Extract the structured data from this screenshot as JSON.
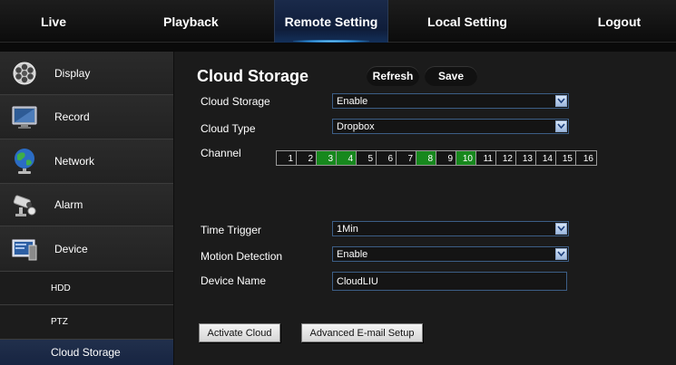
{
  "topnav": {
    "tabs": [
      {
        "label": "Live"
      },
      {
        "label": "Playback"
      },
      {
        "label": "Remote Setting"
      },
      {
        "label": "Local Setting"
      },
      {
        "label": "Logout"
      }
    ],
    "active_tab": "Remote Setting"
  },
  "sidebar": {
    "items": [
      {
        "label": "Display",
        "icon": "film-reel-icon"
      },
      {
        "label": "Record",
        "icon": "monitor-icon"
      },
      {
        "label": "Network",
        "icon": "globe-icon"
      },
      {
        "label": "Alarm",
        "icon": "security-camera-icon"
      },
      {
        "label": "Device",
        "icon": "device-icon"
      }
    ],
    "sub_items": [
      {
        "label": "HDD"
      },
      {
        "label": "PTZ"
      },
      {
        "label": "Cloud Storage"
      }
    ],
    "active_sub_item": "Cloud Storage"
  },
  "main": {
    "title": "Cloud Storage",
    "refresh_label": "Refresh",
    "save_label": "Save",
    "fields": {
      "cloud_storage": {
        "label": "Cloud Storage",
        "value": "Enable"
      },
      "cloud_type": {
        "label": "Cloud Type",
        "value": "Dropbox"
      },
      "channel": {
        "label": "Channel"
      },
      "time_trigger": {
        "label": "Time Trigger",
        "value": "1Min"
      },
      "motion_detection": {
        "label": "Motion Detection",
        "value": "Enable"
      },
      "device_name": {
        "label": "Device Name",
        "value": "CloudLIU"
      }
    },
    "channels": [
      {
        "num": "1",
        "on": false
      },
      {
        "num": "2",
        "on": false
      },
      {
        "num": "3",
        "on": true
      },
      {
        "num": "4",
        "on": true
      },
      {
        "num": "5",
        "on": false
      },
      {
        "num": "6",
        "on": false
      },
      {
        "num": "7",
        "on": false
      },
      {
        "num": "8",
        "on": true
      },
      {
        "num": "9",
        "on": false
      },
      {
        "num": "10",
        "on": true
      },
      {
        "num": "11",
        "on": false
      },
      {
        "num": "12",
        "on": false
      },
      {
        "num": "13",
        "on": false
      },
      {
        "num": "14",
        "on": false
      },
      {
        "num": "15",
        "on": false
      },
      {
        "num": "16",
        "on": false
      }
    ],
    "activate_cloud_label": "Activate Cloud",
    "advanced_email_label": "Advanced E-mail Setup"
  },
  "colors": {
    "channel_on": "#17881d",
    "active_tab": "#13305a",
    "active_sub_item": "#1d2b47",
    "field_border": "#3c5e86"
  }
}
